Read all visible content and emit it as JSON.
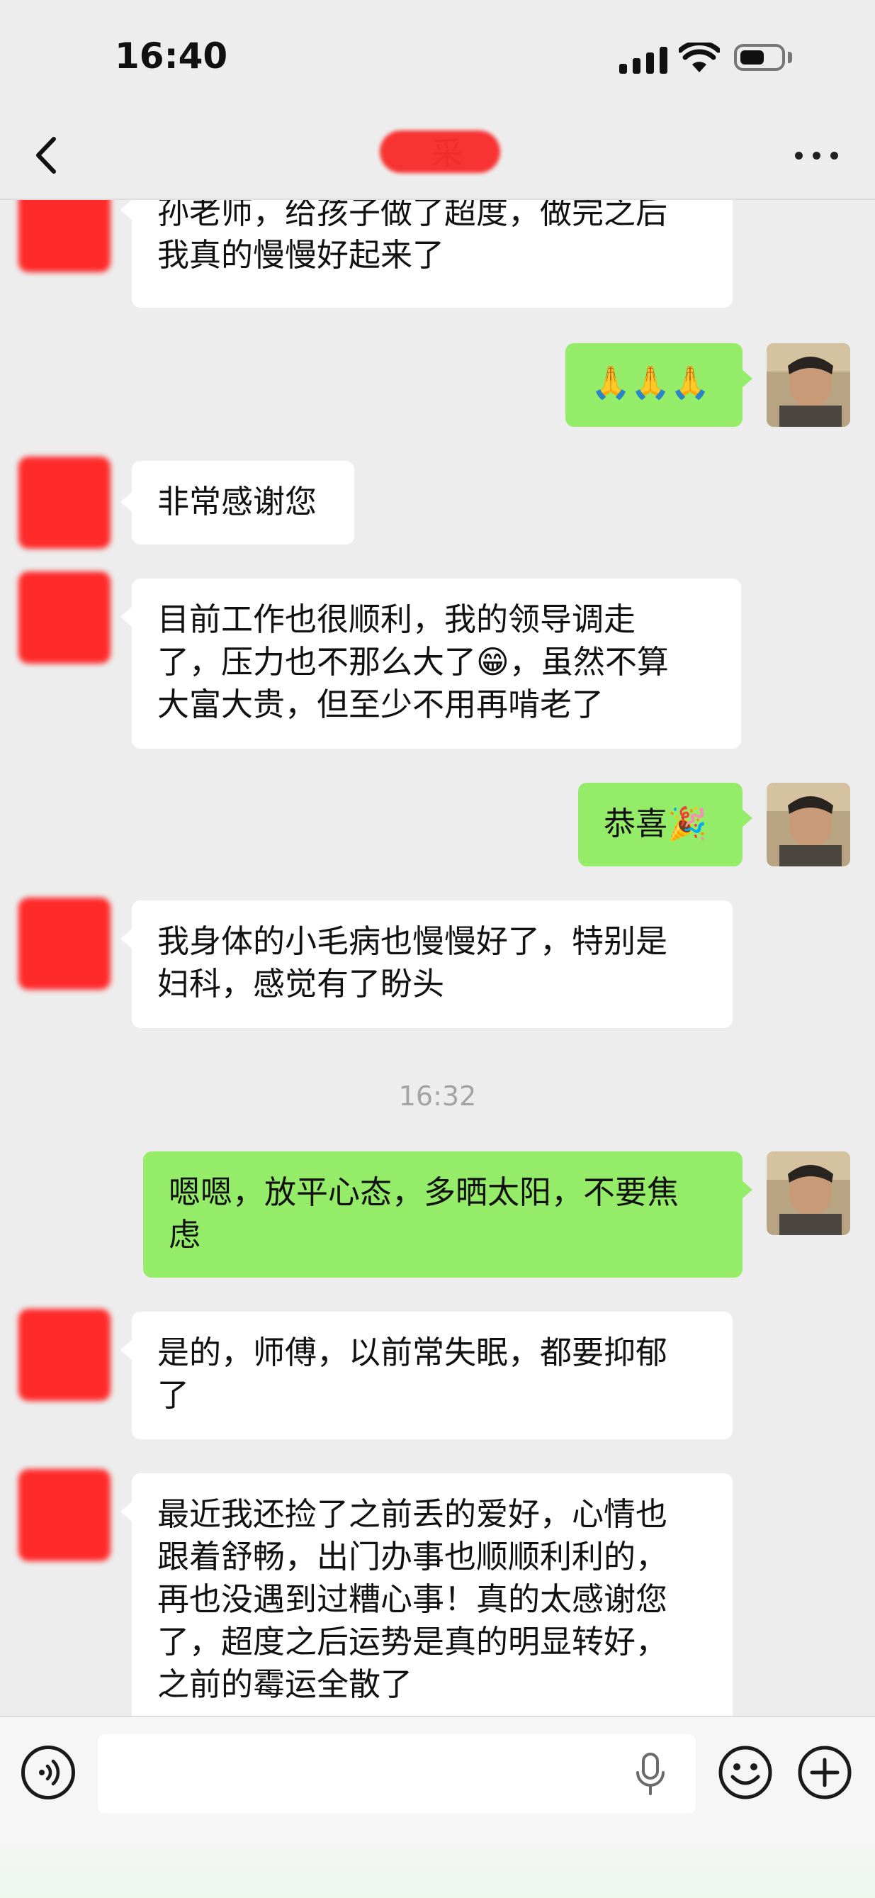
{
  "status_bar": {
    "time": "16:40"
  },
  "header": {
    "contact_name": "采"
  },
  "colors": {
    "incoming_bubble": "#ffffff",
    "outgoing_bubble": "#95ec69",
    "background": "#ededed"
  },
  "messages": [
    {
      "side": "in",
      "text": "孙老师，给孩子做了超度，做完之后\n我真的慢慢好起来了"
    },
    {
      "side": "out",
      "text": "🙏🙏🙏"
    },
    {
      "side": "in",
      "text": "非常感谢您"
    },
    {
      "side": "in",
      "text": "目前工作也很顺利，我的领导调走\n了，压力也不那么大了😁，虽然不算\n大富大贵，但至少不用再啃老了"
    },
    {
      "side": "out",
      "text": "恭喜🎉"
    },
    {
      "side": "in",
      "text": "我身体的小毛病也慢慢好了，特别是\n妇科，感觉有了盼头"
    },
    {
      "timestamp": "16:32"
    },
    {
      "side": "out",
      "text": "嗯嗯，放平心态，多晒太阳，不要焦\n虑"
    },
    {
      "side": "in",
      "text": "是的，师傅，以前常失眠，都要抑郁\n了"
    },
    {
      "side": "in",
      "text": "最近我还捡了之前丢的爱好，心情也\n跟着舒畅，出门办事也顺顺利利的，\n再也没遇到过糟心事！真的太感谢您\n了，超度之后运势是真的明显转好，\n之前的霉运全散了"
    }
  ],
  "input_bar": {
    "placeholder": ""
  },
  "icons": {
    "back": "chevron-left-icon",
    "more": "more-icon",
    "voice": "voice-icon",
    "mic": "mic-icon",
    "emoji": "emoji-icon",
    "plus": "plus-icon"
  }
}
